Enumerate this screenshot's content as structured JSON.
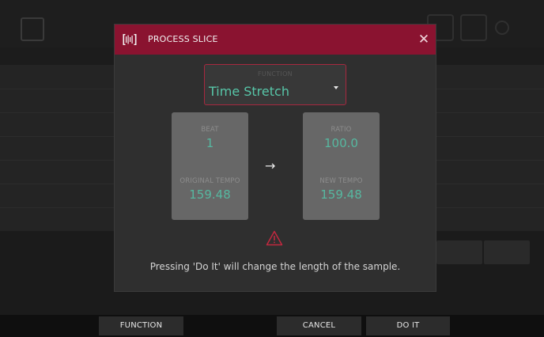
{
  "dialog": {
    "title": "PROCESS SLICE",
    "close_glyph": "✕",
    "function": {
      "label": "FUNCTION",
      "value": "Time Stretch"
    },
    "left_panel": {
      "beat_label": "BEAT",
      "beat_value": "1",
      "original_tempo_label": "ORIGINAL TEMPO",
      "original_tempo_value": "159.48"
    },
    "right_panel": {
      "ratio_label": "RATIO",
      "ratio_value": "100.0",
      "new_tempo_label": "NEW TEMPO",
      "new_tempo_value": "159.48"
    },
    "arrow_glyph": "→",
    "message": "Pressing 'Do It' will change the length of the sample."
  },
  "footer": {
    "function_label": "FUNCTION",
    "cancel_label": "CANCEL",
    "do_it_label": "DO IT"
  },
  "colors": {
    "header": "#8a1330",
    "accent_teal": "#57c6a8",
    "select_border": "#a8283f",
    "warning": "#c2283f"
  },
  "icons": [
    "waveform-icon",
    "close-icon",
    "dropdown-caret-icon",
    "arrow-right-icon",
    "warning-icon"
  ]
}
